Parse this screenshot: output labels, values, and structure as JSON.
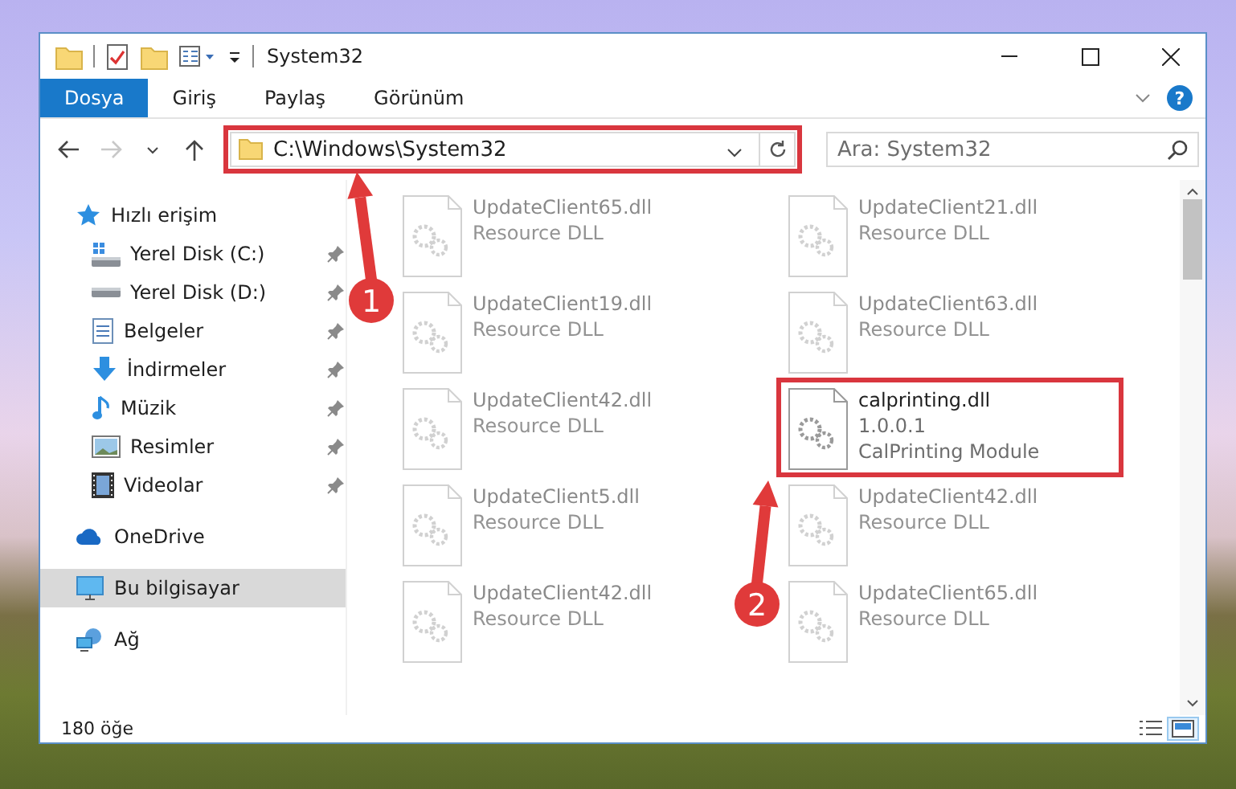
{
  "window": {
    "title": "System32"
  },
  "ribbon_tabs": [
    {
      "label": "Dosya",
      "selected": true
    },
    {
      "label": "Giriş",
      "selected": false
    },
    {
      "label": "Paylaş",
      "selected": false
    },
    {
      "label": "Görünüm",
      "selected": false
    }
  ],
  "help_button": "?",
  "navigation": {
    "forward_disabled": true
  },
  "address_bar": {
    "path": "C:\\Windows\\System32",
    "highlighted": true
  },
  "search": {
    "placeholder": "Ara: System32"
  },
  "sidebar": {
    "items": [
      {
        "label": "Hızlı erişim",
        "kind": "star",
        "selected": false,
        "children": [
          {
            "label": "Yerel Disk (C:)",
            "kind": "drive-windows",
            "pinned": true
          },
          {
            "label": "Yerel Disk (D:)",
            "kind": "drive",
            "pinned": true
          },
          {
            "label": "Belgeler",
            "kind": "documents",
            "pinned": true
          },
          {
            "label": "İndirmeler",
            "kind": "download",
            "pinned": true
          },
          {
            "label": "Müzik",
            "kind": "music",
            "pinned": true
          },
          {
            "label": "Resimler",
            "kind": "pictures",
            "pinned": true
          },
          {
            "label": "Videolar",
            "kind": "video",
            "pinned": true
          }
        ]
      },
      {
        "label": "OneDrive",
        "kind": "cloud",
        "selected": false
      },
      {
        "label": "Bu bilgisayar",
        "kind": "computer",
        "selected": true
      },
      {
        "label": "Ağ",
        "kind": "network",
        "selected": false
      }
    ]
  },
  "files": [
    {
      "name": "UpdateClient65.dll",
      "details": [
        "Resource DLL"
      ],
      "kind": "blurred",
      "highlighted": false
    },
    {
      "name": "UpdateClient21.dll",
      "details": [
        "Resource DLL"
      ],
      "kind": "blurred",
      "highlighted": false
    },
    {
      "name": "UpdateClient19.dll",
      "details": [
        "Resource DLL"
      ],
      "kind": "blurred",
      "highlighted": false
    },
    {
      "name": "UpdateClient63.dll",
      "details": [
        "Resource DLL"
      ],
      "kind": "blurred",
      "highlighted": false
    },
    {
      "name": "UpdateClient42.dll",
      "details": [
        "Resource DLL"
      ],
      "kind": "blurred",
      "highlighted": false
    },
    {
      "name": "calprinting.dll",
      "details": [
        "1.0.0.1",
        "CalPrinting Module"
      ],
      "kind": "clear",
      "highlighted": true
    },
    {
      "name": "UpdateClient5.dll",
      "details": [
        "Resource DLL"
      ],
      "kind": "blurred",
      "highlighted": false
    },
    {
      "name": "UpdateClient42.dll",
      "details": [
        "Resource DLL"
      ],
      "kind": "blurred",
      "highlighted": false
    },
    {
      "name": "UpdateClient42.dll",
      "details": [
        "Resource DLL"
      ],
      "kind": "blurred",
      "highlighted": false
    },
    {
      "name": "UpdateClient65.dll",
      "details": [
        "Resource DLL"
      ],
      "kind": "blurred",
      "highlighted": false
    }
  ],
  "annotations": [
    {
      "label": "1"
    },
    {
      "label": "2"
    }
  ],
  "status_bar": {
    "item_count": "180 öğe",
    "view_buttons": [
      {
        "kind": "details",
        "selected": false
      },
      {
        "kind": "tiles",
        "selected": true
      }
    ]
  }
}
